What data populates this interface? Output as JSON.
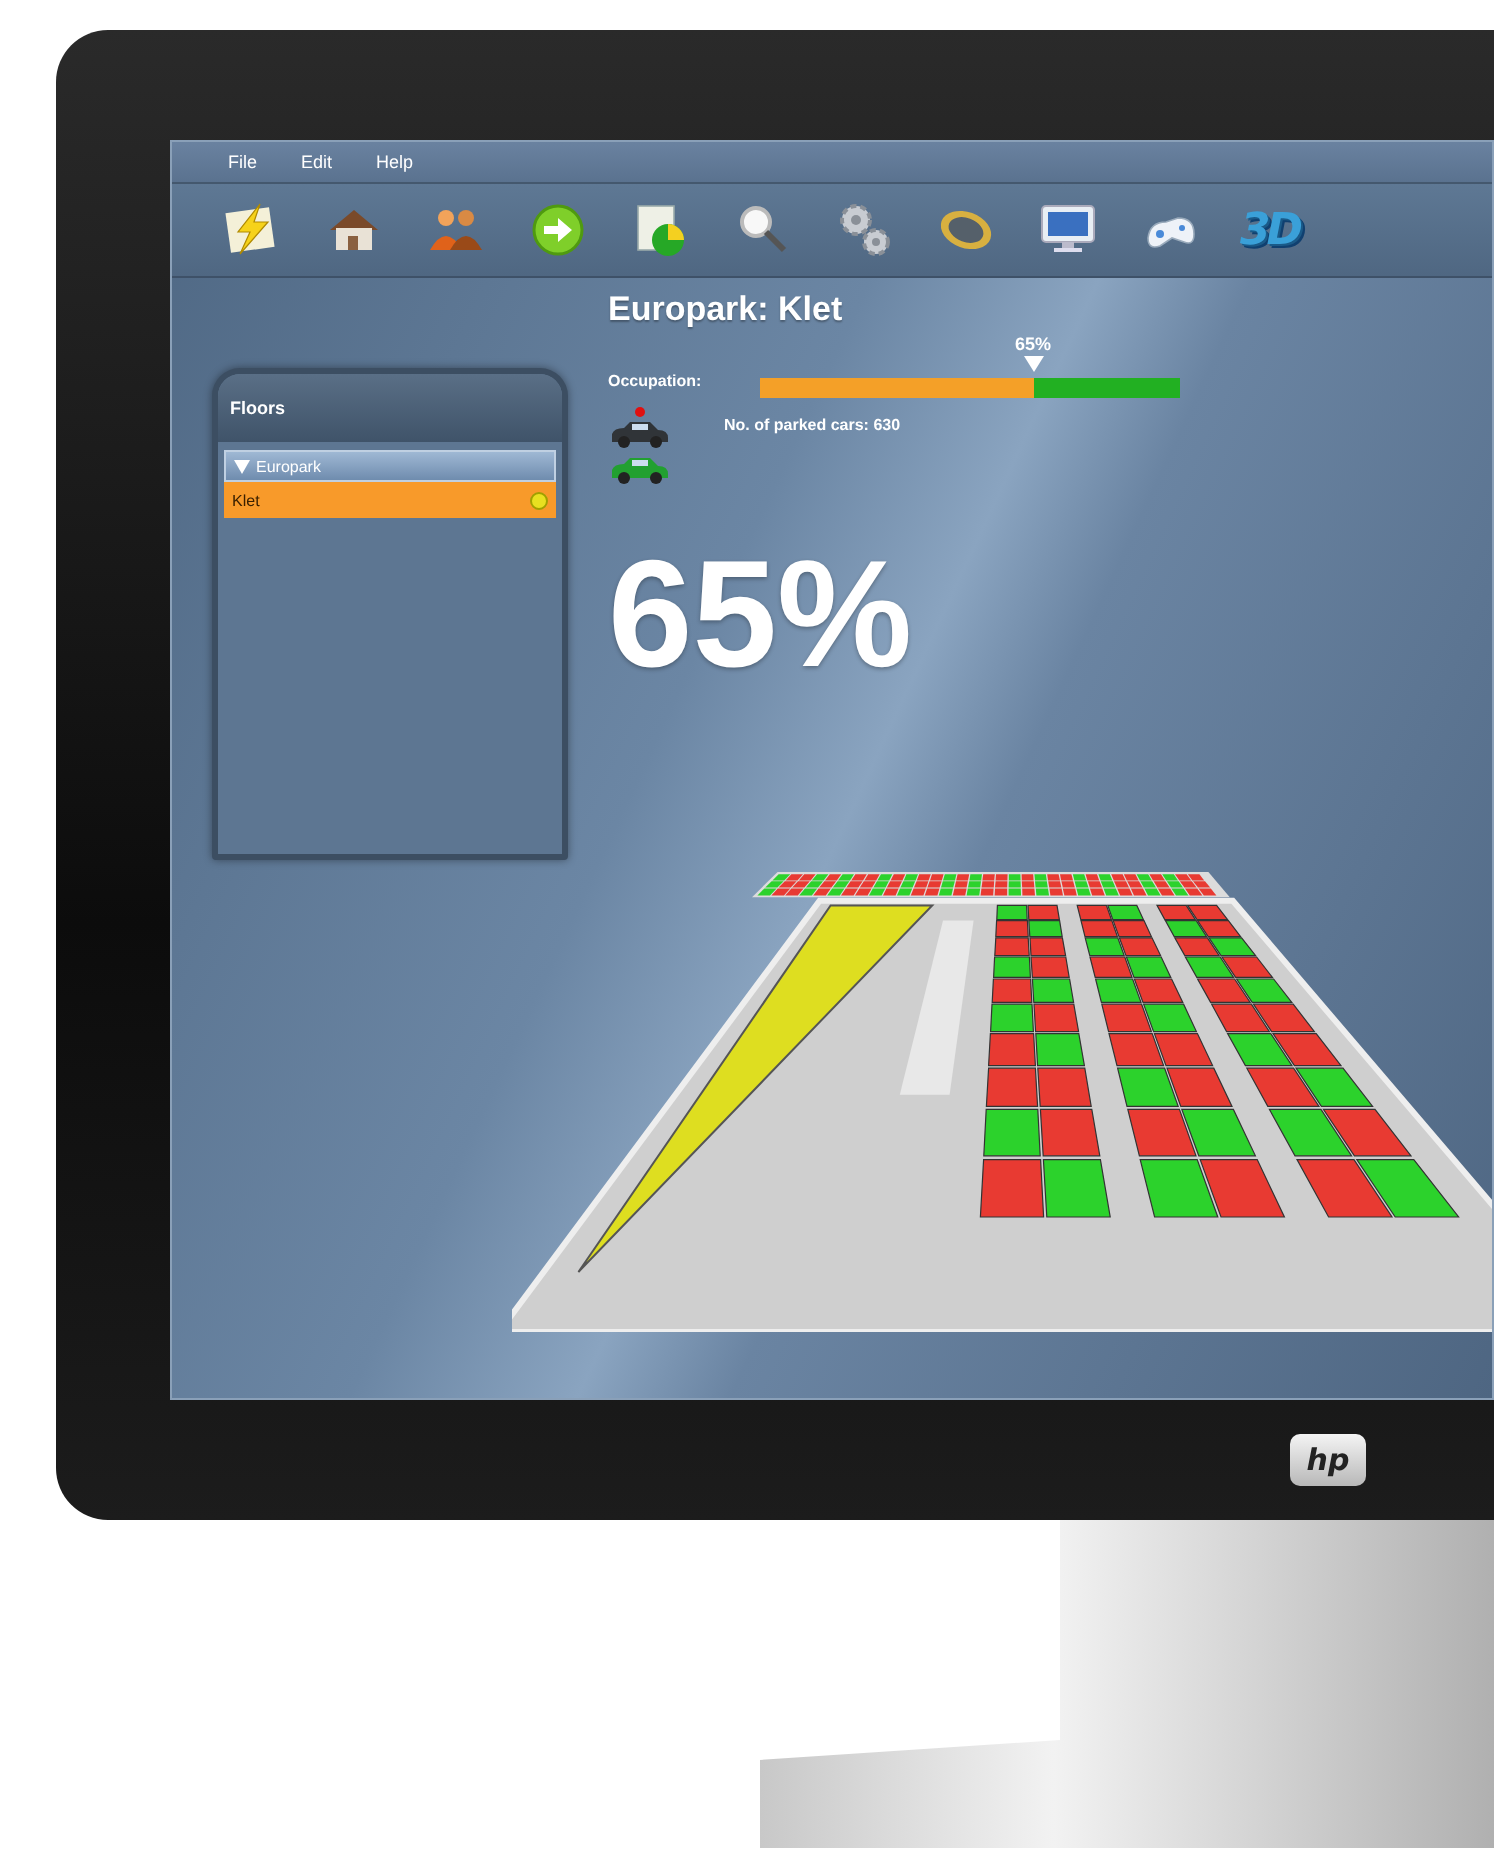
{
  "menu": [
    {
      "label": "File"
    },
    {
      "label": "Edit"
    },
    {
      "label": "Help"
    }
  ],
  "toolbar": {
    "view_3d_label": "3D"
  },
  "floors_panel": {
    "title": "Floors",
    "tree": [
      {
        "label": "Europark",
        "expanded": true,
        "children": [
          {
            "label": "Klet",
            "selected": true
          }
        ]
      }
    ]
  },
  "header": {
    "title": "Europark: Klet",
    "occupation_label": "Occupation:",
    "occupation": {
      "level": 0.65,
      "reading": "65%"
    },
    "parked_cars": "No. of parked cars: 630",
    "big_percent": "65%"
  },
  "monitor": {
    "logo": "hp"
  }
}
